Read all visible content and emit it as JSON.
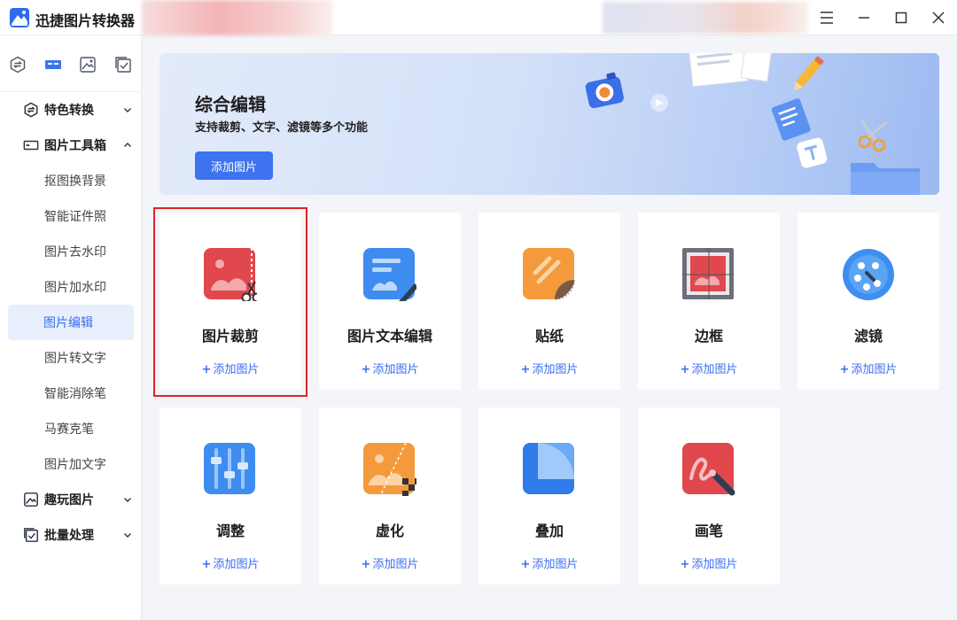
{
  "app": {
    "title": "迅捷图片转换器"
  },
  "sidebar": {
    "top_icons": [
      "convert-icon",
      "toolbox-icon",
      "image-icon",
      "batch-icon"
    ],
    "groups": [
      {
        "label": "特色转换",
        "icon": "convert-icon",
        "expanded": false
      },
      {
        "label": "图片工具箱",
        "icon": "toolbox-icon",
        "expanded": true
      },
      {
        "label": "趣玩图片",
        "icon": "image-icon",
        "expanded": false
      },
      {
        "label": "批量处理",
        "icon": "batch-icon",
        "expanded": false
      }
    ],
    "tools": [
      "抠图换背景",
      "智能证件照",
      "图片去水印",
      "图片加水印",
      "图片编辑",
      "图片转文字",
      "智能消除笔",
      "马赛克笔",
      "图片加文字"
    ],
    "active_tool": "图片编辑"
  },
  "banner": {
    "title": "综合编辑",
    "subtitle": "支持裁剪、文字、滤镜等多个功能",
    "button": "添加图片"
  },
  "cards": [
    {
      "title": "图片裁剪",
      "add": "添加图片",
      "icon": "crop-icon",
      "selected": true
    },
    {
      "title": "图片文本编辑",
      "add": "添加图片",
      "icon": "text-edit-icon"
    },
    {
      "title": "贴纸",
      "add": "添加图片",
      "icon": "sticker-icon"
    },
    {
      "title": "边框",
      "add": "添加图片",
      "icon": "frame-icon"
    },
    {
      "title": "滤镜",
      "add": "添加图片",
      "icon": "filter-icon"
    },
    {
      "title": "调整",
      "add": "添加图片",
      "icon": "adjust-icon"
    },
    {
      "title": "虚化",
      "add": "添加图片",
      "icon": "blur-icon"
    },
    {
      "title": "叠加",
      "add": "添加图片",
      "icon": "overlay-icon"
    },
    {
      "title": "画笔",
      "add": "添加图片",
      "icon": "brush-icon"
    }
  ],
  "colors": {
    "accent": "#3d73ef",
    "selection": "#e02323",
    "active_bg": "#e8eefc"
  }
}
